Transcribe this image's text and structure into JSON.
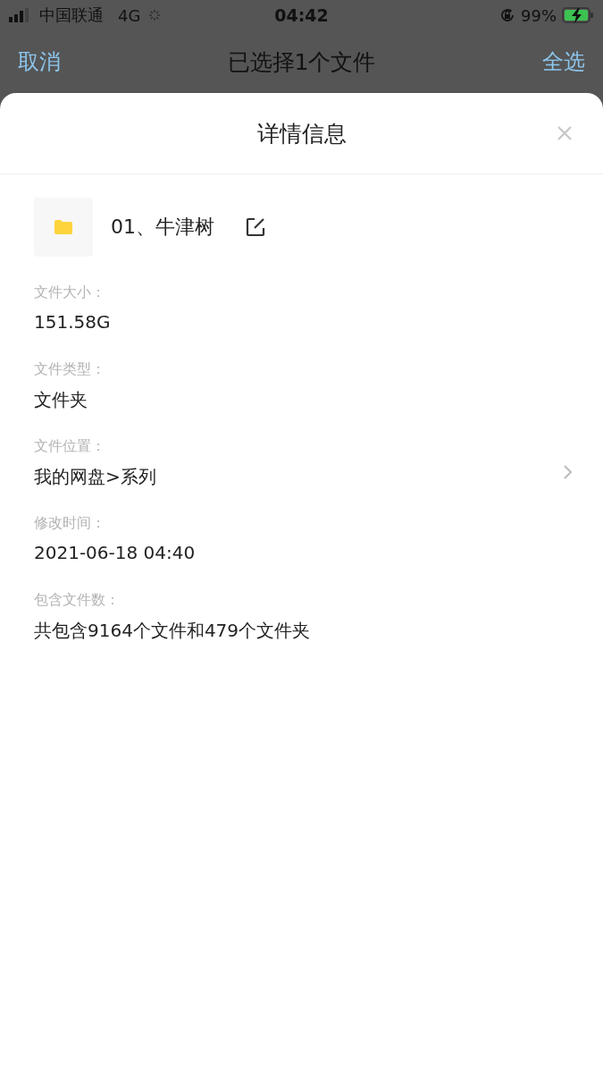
{
  "status_bar": {
    "carrier": "中国联通",
    "network": "4G",
    "time": "04:42",
    "battery": "99%"
  },
  "nav": {
    "cancel": "取消",
    "title": "已选择1个文件",
    "select_all": "全选"
  },
  "sheet": {
    "title": "详情信息",
    "file_name": "01、牛津树",
    "fields": [
      {
        "kind": "plain",
        "label": "文件大小：",
        "value": "151.58G"
      },
      {
        "kind": "plain",
        "label": "文件类型：",
        "value": "文件夹"
      },
      {
        "kind": "link",
        "label": "文件位置：",
        "value": "我的网盘>系列"
      },
      {
        "kind": "plain",
        "label": "修改时间：",
        "value": "2021-06-18 04:40"
      },
      {
        "kind": "plain",
        "label": "包含文件数：",
        "value": "共包含9164个文件和479个文件夹"
      }
    ]
  }
}
